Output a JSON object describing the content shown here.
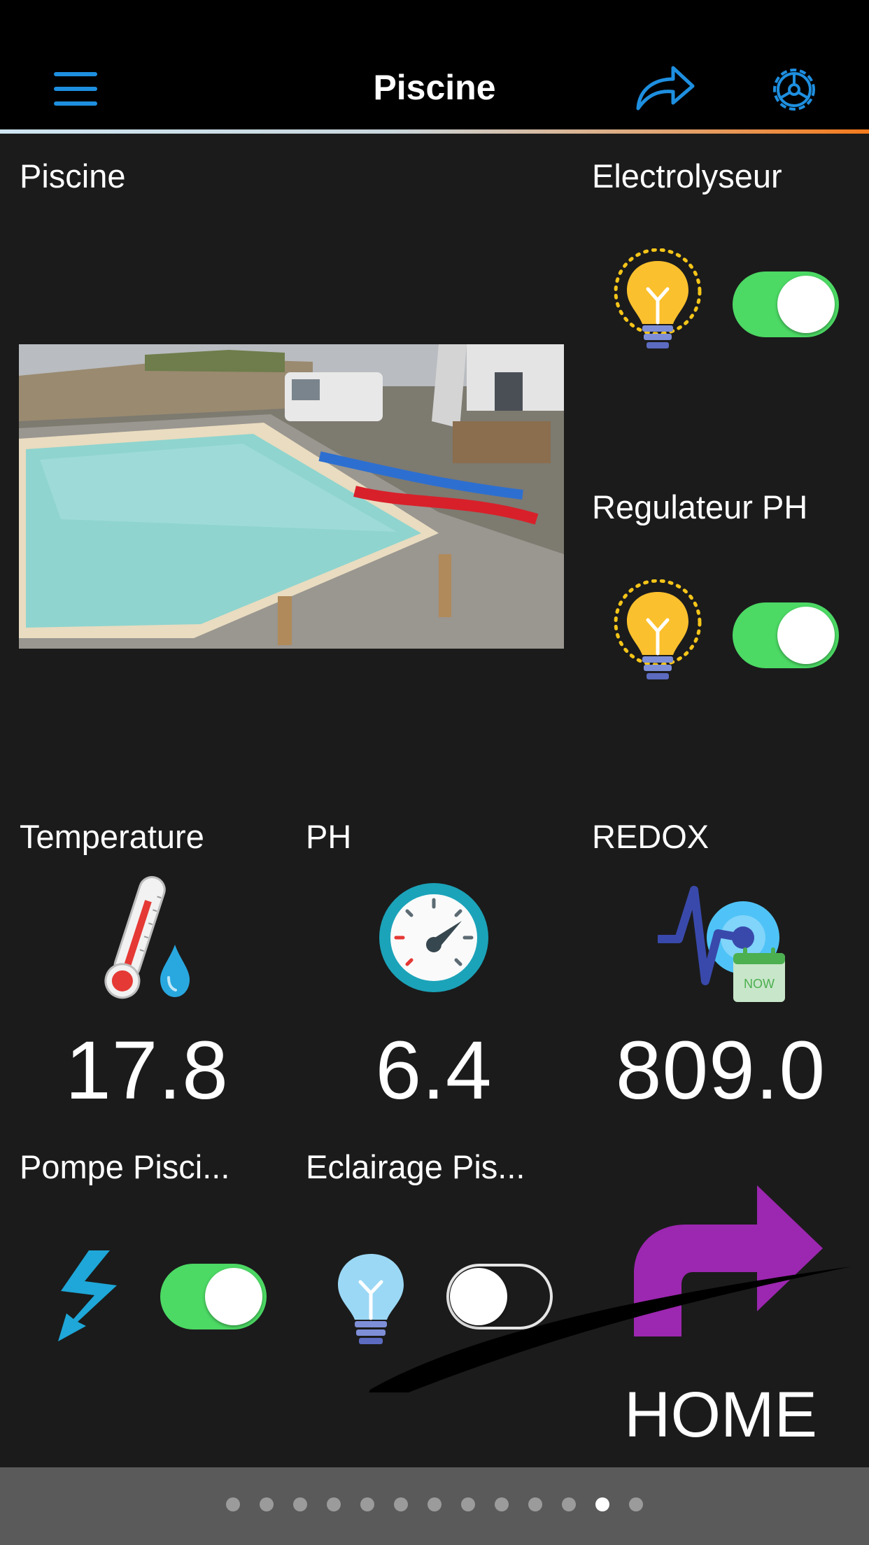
{
  "header": {
    "title": "Piscine",
    "menu_icon": "hamburger-menu-icon",
    "share_icon": "share-arrow-icon",
    "settings_icon": "gear-settings-icon",
    "accent_color": "#1e8fe0"
  },
  "camera": {
    "label": "Piscine"
  },
  "switches": {
    "electrolyseur": {
      "label": "Electrolyseur",
      "state": "on"
    },
    "regulateur_ph": {
      "label": "Regulateur PH",
      "state": "on"
    },
    "pompe": {
      "label": "Pompe Pisci...",
      "state": "on"
    },
    "eclairage": {
      "label": "Eclairage Pis...",
      "state": "off"
    }
  },
  "sensors": {
    "temperature": {
      "label": "Temperature",
      "value": "17.8"
    },
    "ph": {
      "label": "PH",
      "value": "6.4"
    },
    "redox": {
      "label": "REDOX",
      "value": "809.0",
      "badge": "NOW"
    }
  },
  "home": {
    "label": "HOME",
    "icon": "turn-right-arrow-icon",
    "color": "#9c27b0"
  },
  "pager": {
    "page_count": 13,
    "active_index": 11
  },
  "colors": {
    "toggle_on": "#4cd964",
    "background": "#1b1b1b"
  }
}
